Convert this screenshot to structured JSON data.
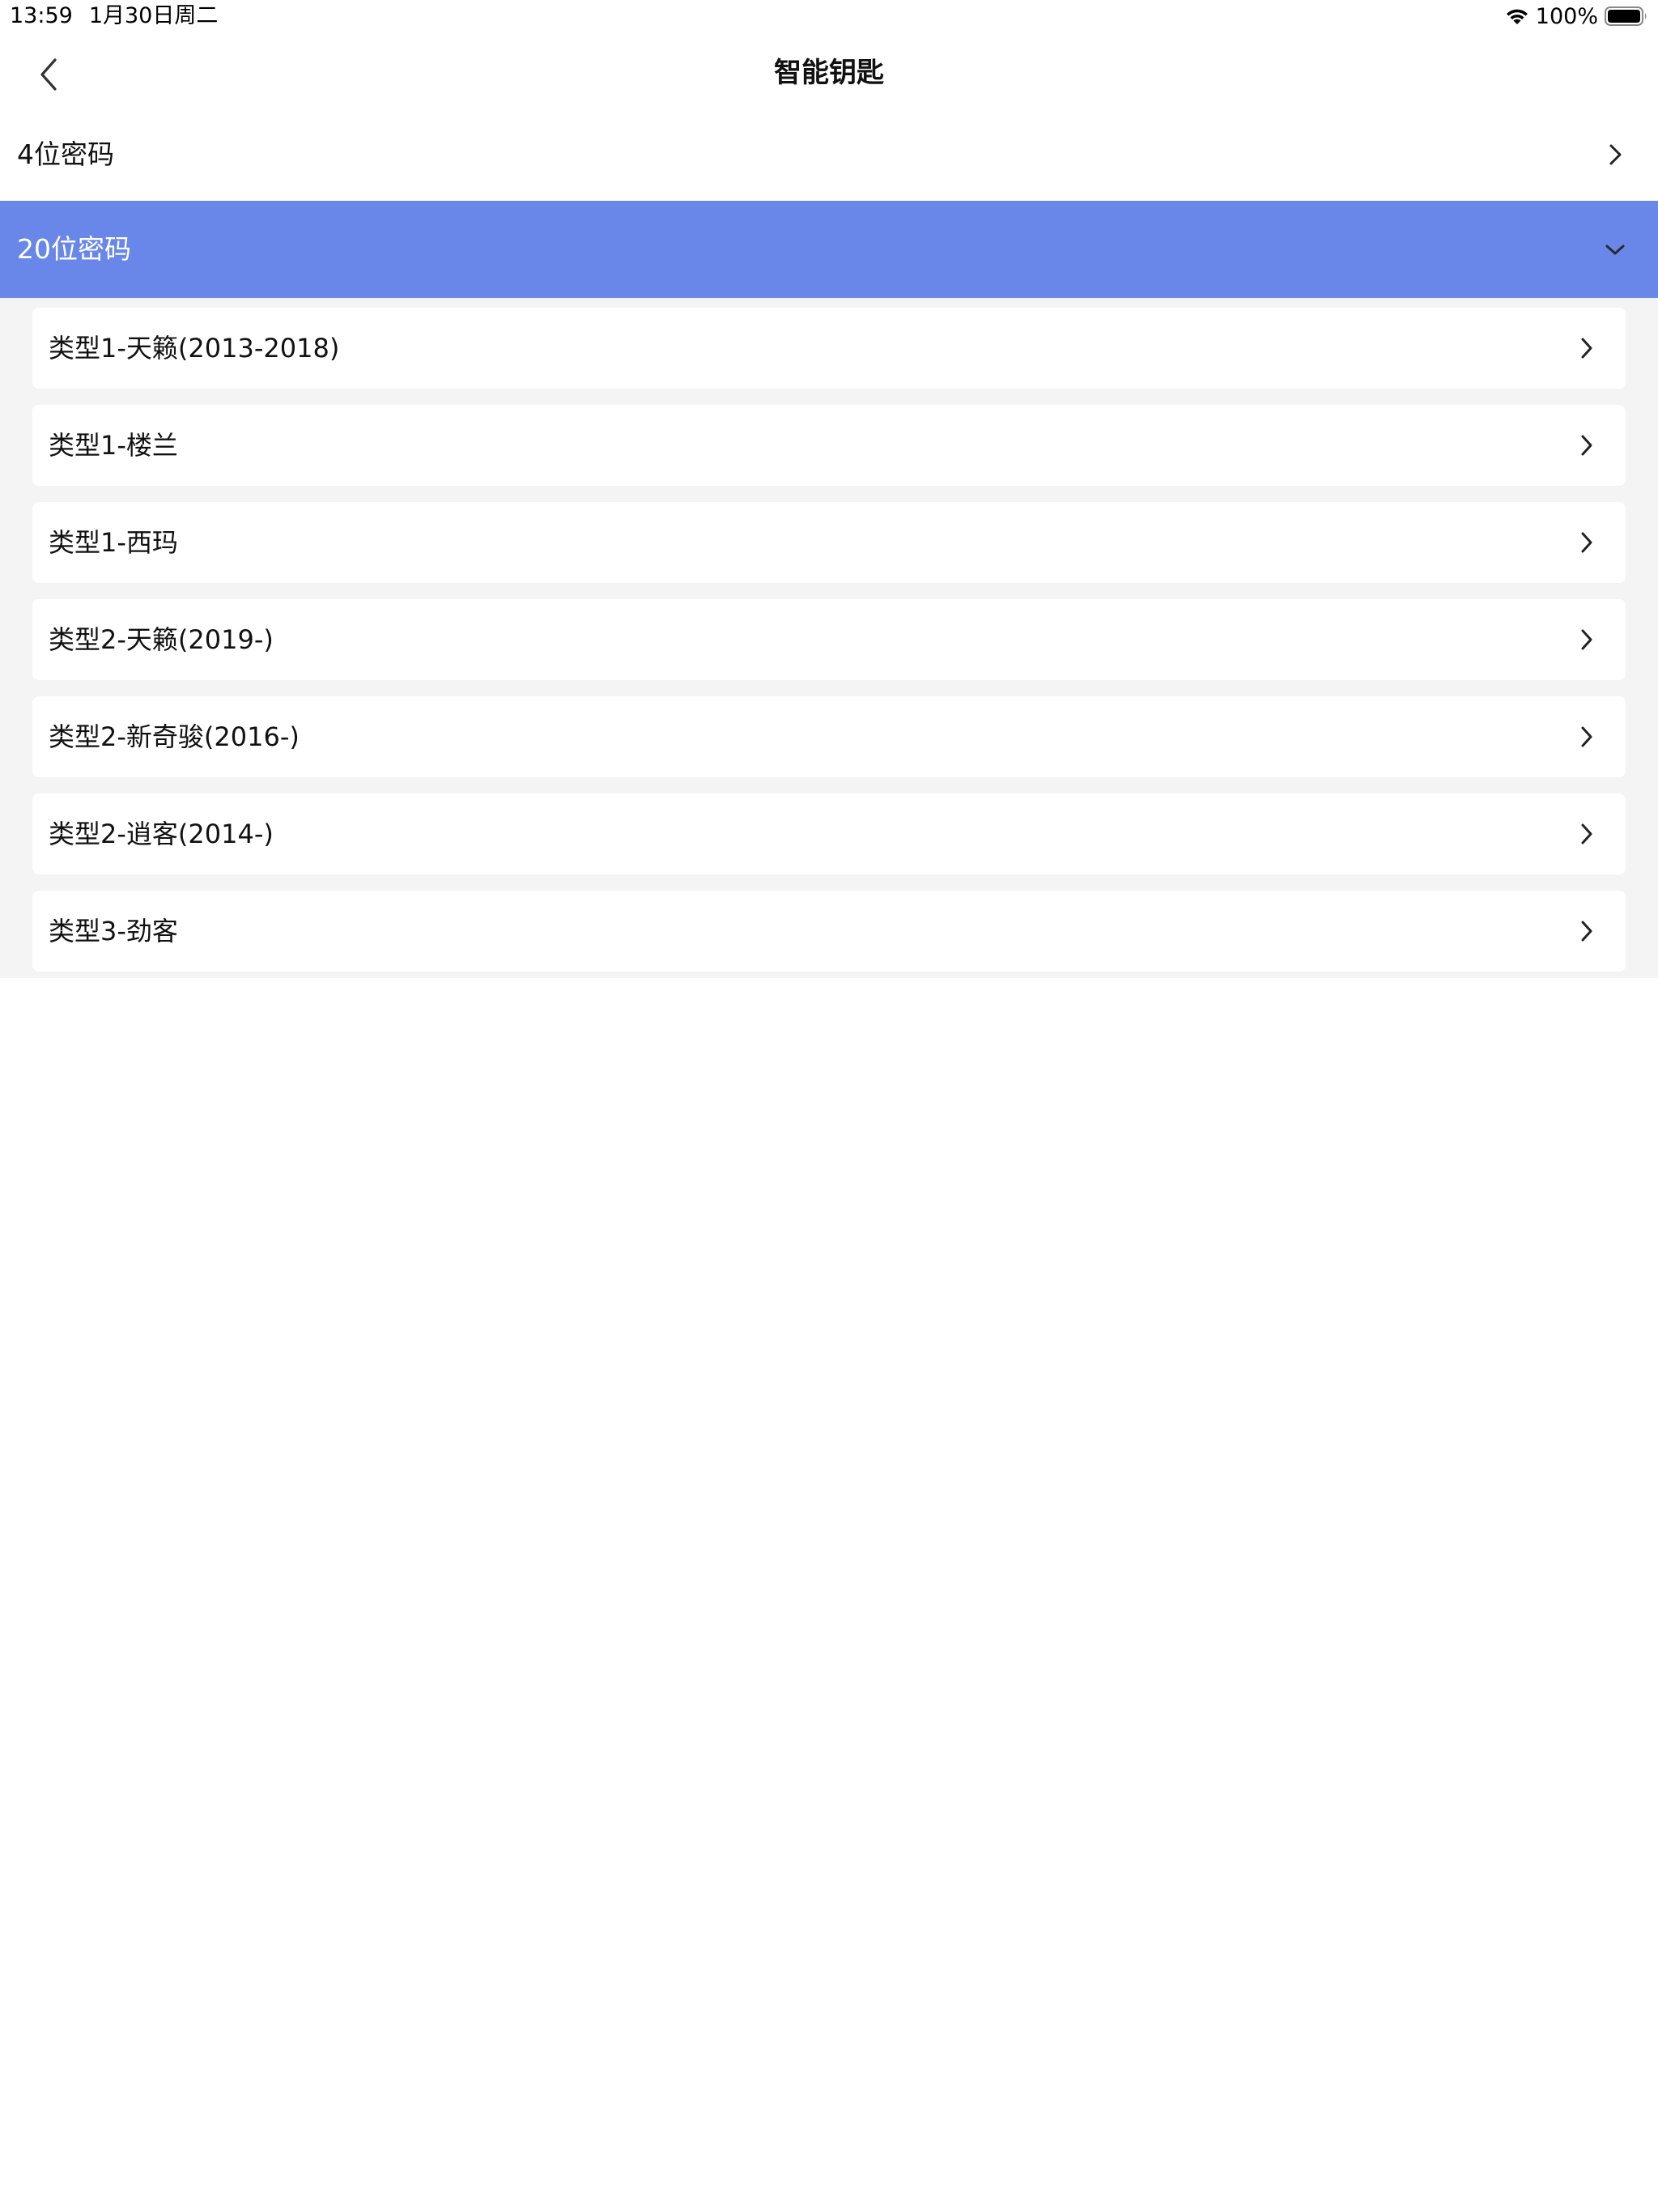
{
  "status_bar": {
    "time": "13:59",
    "date": "1月30日周二",
    "battery": "100%",
    "wifi_icon": "wifi-icon",
    "battery_icon": "battery-icon"
  },
  "nav": {
    "title": "智能钥匙",
    "back_icon": "chevron-left-icon"
  },
  "sections": [
    {
      "label": "4位密码",
      "expanded": false,
      "icon": "chevron-right-icon"
    },
    {
      "label": "20位密码",
      "expanded": true,
      "icon": "chevron-down-icon"
    }
  ],
  "sub_items": [
    {
      "label": "类型1-天籁(2013-2018)"
    },
    {
      "label": "类型1-楼兰"
    },
    {
      "label": "类型1-西玛"
    },
    {
      "label": "类型2-天籁(2019-)"
    },
    {
      "label": "类型2-新奇骏(2016-)"
    },
    {
      "label": "类型2-逍客(2014-)"
    },
    {
      "label": "类型3-劲客"
    }
  ],
  "colors": {
    "accent": "#6887e8",
    "list_background": "#f4f4f4"
  }
}
